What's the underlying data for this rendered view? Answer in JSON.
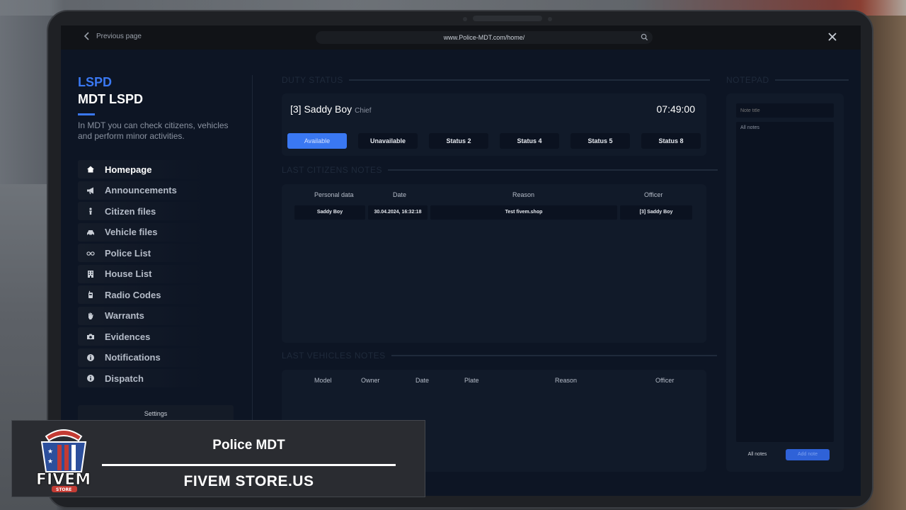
{
  "browser": {
    "back_label": "Previous page",
    "url": "www.Police-MDT.com/home/"
  },
  "sidebar": {
    "org": "LSPD",
    "title": "MDT LSPD",
    "description": "In MDT you can check citizens, vehicles and perform minor activities.",
    "items": [
      {
        "label": "Homepage",
        "icon": "home-icon"
      },
      {
        "label": "Announcements",
        "icon": "megaphone-icon"
      },
      {
        "label": "Citizen files",
        "icon": "person-icon"
      },
      {
        "label": "Vehicle files",
        "icon": "car-icon"
      },
      {
        "label": "Police List",
        "icon": "glasses-icon"
      },
      {
        "label": "House List",
        "icon": "building-icon"
      },
      {
        "label": "Radio Codes",
        "icon": "radio-icon"
      },
      {
        "label": "Warrants",
        "icon": "hand-icon"
      },
      {
        "label": "Evidences",
        "icon": "camera-icon"
      },
      {
        "label": "Notifications",
        "icon": "info-icon"
      },
      {
        "label": "Dispatch",
        "icon": "info-icon"
      }
    ],
    "settings_label": "Settings"
  },
  "duty": {
    "section_label": "DUTY STATUS",
    "officer_name": "[3] Saddy Boy",
    "officer_rank": "Chief",
    "time": "07:49:00",
    "statuses": [
      "Available",
      "Unavailable",
      "Status 2",
      "Status 4",
      "Status 5",
      "Status 8"
    ],
    "active_status": "Available"
  },
  "citizen_notes": {
    "section_label": "LAST CITIZENS NOTES",
    "columns": [
      "Personal data",
      "Date",
      "Reason",
      "Officer"
    ],
    "rows": [
      [
        "Saddy Boy",
        "30.04.2024, 16:32:18",
        "Test fivem.shop",
        "[3] Saddy Boy"
      ]
    ]
  },
  "vehicle_notes": {
    "section_label": "LAST VEHICLES NOTES",
    "columns": [
      "Model",
      "Owner",
      "Date",
      "Plate",
      "Reason",
      "Officer"
    ]
  },
  "notepad": {
    "section_label": "NOTEPAD",
    "title_placeholder": "Note title",
    "notes_placeholder": "All notes",
    "all_notes_label": "All notes",
    "add_note_label": "Add note"
  },
  "promo": {
    "title": "Police MDT",
    "subtitle": "FIVEM STORE.US",
    "logo_text": "FIVEM",
    "logo_badge": "STORE"
  },
  "colors": {
    "accent": "#3a78f2",
    "screen_bg": "#0d1524",
    "panel_bg": "#111a29"
  }
}
